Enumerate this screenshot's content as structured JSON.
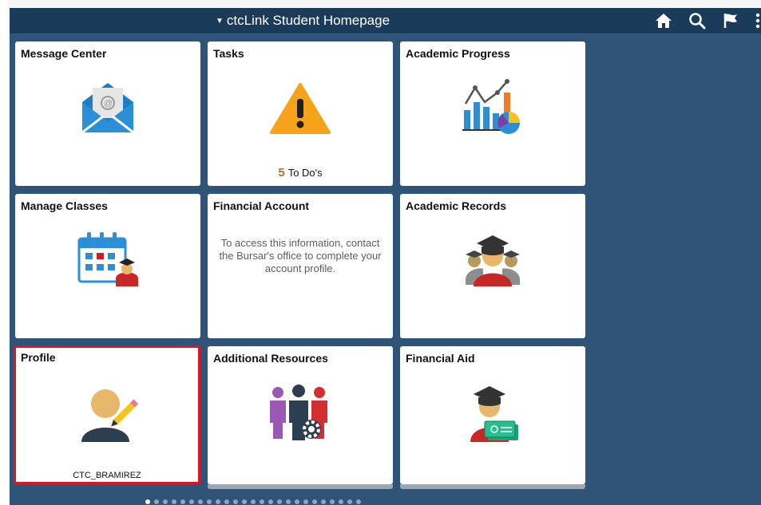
{
  "header": {
    "title": "ctcLink Student Homepage",
    "icons": [
      "home-icon",
      "search-icon",
      "flag-icon",
      "kebab-menu-icon"
    ]
  },
  "tiles": [
    {
      "label": "Message Center",
      "icon": "envelope-icon"
    },
    {
      "label": "Tasks",
      "icon": "warning-icon",
      "todo_count": "5",
      "todo_label": "To Do's"
    },
    {
      "label": "Academic Progress",
      "icon": "chart-icon"
    },
    {
      "label": "Manage Classes",
      "icon": "calendar-student-icon"
    },
    {
      "label": "Financial Account",
      "icon": "none",
      "message": "To access this information, contact the Bursar's office to complete your account profile."
    },
    {
      "label": "Academic Records",
      "icon": "graduates-icon"
    },
    {
      "label": "Profile",
      "icon": "user-edit-icon",
      "username": "CTC_BRAMIREZ",
      "selected": true
    },
    {
      "label": "Additional Resources",
      "icon": "people-gear-icon"
    },
    {
      "label": "Financial Aid",
      "icon": "graduate-money-icon"
    }
  ],
  "pagination": {
    "count": 25,
    "active_index": 0
  },
  "colors": {
    "background": "#2f5478",
    "header": "#1b3b5b",
    "selected_border": "#e0151d"
  }
}
